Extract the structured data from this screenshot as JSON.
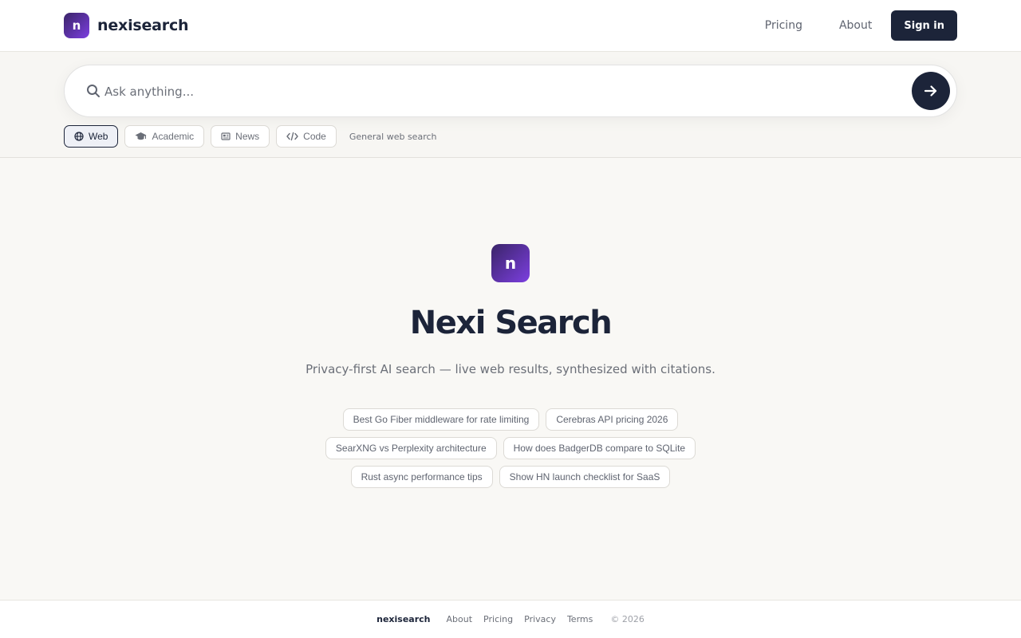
{
  "header": {
    "logo_letter": "n",
    "brand": "nexisearch",
    "nav": [
      {
        "label": "Pricing"
      },
      {
        "label": "About"
      }
    ],
    "signin_label": "Sign in"
  },
  "search": {
    "placeholder": "Ask anything...",
    "value": ""
  },
  "modes": {
    "items": [
      {
        "label": "Web",
        "icon": "globe-icon",
        "active": true
      },
      {
        "label": "Academic",
        "icon": "graduation-cap-icon",
        "active": false
      },
      {
        "label": "News",
        "icon": "newspaper-icon",
        "active": false
      },
      {
        "label": "Code",
        "icon": "code-icon",
        "active": false
      }
    ],
    "description": "General web search"
  },
  "hero": {
    "logo_letter": "n",
    "title": "Nexi Search",
    "subtitle": "Privacy-first AI search — live web results, synthesized with citations."
  },
  "suggestions": [
    [
      "Best Go Fiber middleware for rate limiting",
      "Cerebras API pricing 2026"
    ],
    [
      "SearXNG vs Perplexity architecture",
      "How does BadgerDB compare to SQLite"
    ],
    [
      "Rust async performance tips",
      "Show HN launch checklist for SaaS"
    ]
  ],
  "footer": {
    "brand": "nexisearch",
    "links": [
      "About",
      "Pricing",
      "Privacy",
      "Terms"
    ],
    "copyright": "© 2026"
  },
  "colors": {
    "primary": "#1c2439",
    "logo_gradient_start": "#3a2468",
    "logo_gradient_end": "#7c3fe0",
    "background": "#f9f8f5"
  }
}
